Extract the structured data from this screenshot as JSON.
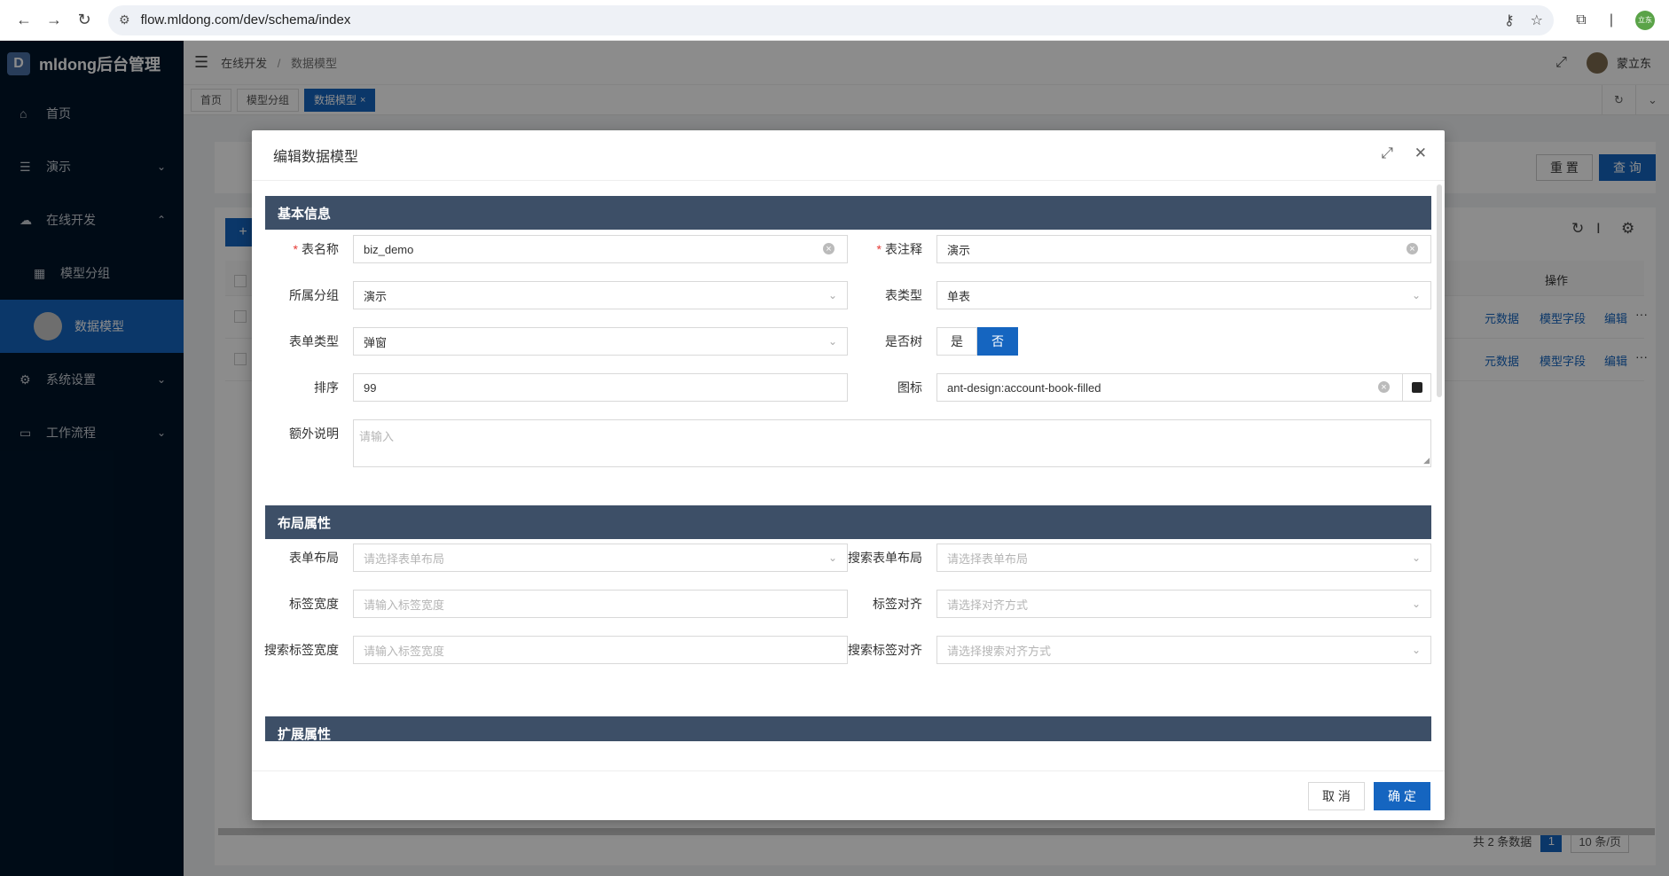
{
  "browser": {
    "url": "flow.mldong.com/dev/schema/index"
  },
  "sidebar": {
    "logo_letter": "D",
    "app_title": "mldong后台管理",
    "items": [
      {
        "label": "首页"
      },
      {
        "label": "演示"
      },
      {
        "label": "在线开发"
      },
      {
        "label": "模型分组"
      },
      {
        "label": "数据模型"
      },
      {
        "label": "系统设置"
      },
      {
        "label": "工作流程"
      }
    ]
  },
  "header": {
    "breadcrumb_parent": "在线开发",
    "breadcrumb_current": "数据模型",
    "breadcrumb_sep": "/",
    "username": "蒙立东",
    "profile_badge": "立东"
  },
  "tabs": [
    {
      "label": "首页"
    },
    {
      "label": "模型分组"
    },
    {
      "label": "数据模型"
    }
  ],
  "search_form": {
    "reset_label": "重 置",
    "query_label": "查 询"
  },
  "table": {
    "add_label": "+",
    "op_header": "操作",
    "row_actions": [
      "元数据",
      "模型字段",
      "编辑",
      "···"
    ],
    "rows": 2
  },
  "pagination": {
    "total_text": "共 2 条数据",
    "current_page": "1",
    "page_size": "10 条/页"
  },
  "modal": {
    "title": "编辑数据模型",
    "sections": {
      "basic": "基本信息",
      "layout": "布局属性",
      "extend": "扩展属性"
    },
    "fields": {
      "table_name_label": "表名称",
      "table_name_value": "biz_demo",
      "table_comment_label": "表注释",
      "table_comment_value": "演示",
      "group_label": "所属分组",
      "group_value": "演示",
      "table_type_label": "表类型",
      "table_type_value": "单表",
      "form_type_label": "表单类型",
      "form_type_value": "弹窗",
      "is_tree_label": "是否树",
      "is_tree_yes": "是",
      "is_tree_no": "否",
      "sort_label": "排序",
      "sort_value": "99",
      "icon_label": "图标",
      "icon_value": "ant-design:account-book-filled",
      "remark_label": "额外说明",
      "remark_placeholder": "请输入",
      "form_layout_label": "表单布局",
      "form_layout_placeholder": "请选择表单布局",
      "search_form_layout_label": "搜索表单布局",
      "search_form_layout_placeholder": "请选择表单布局",
      "label_width_label": "标签宽度",
      "label_width_placeholder": "请输入标签宽度",
      "label_align_label": "标签对齐",
      "label_align_placeholder": "请选择对齐方式",
      "search_label_width_label": "搜索标签宽度",
      "search_label_width_placeholder": "请输入标签宽度",
      "search_label_align_label": "搜索标签对齐",
      "search_label_align_placeholder": "请选择搜索对齐方式"
    },
    "cancel_label": "取 消",
    "ok_label": "确 定"
  },
  "colors": {
    "primary": "#1565c0",
    "sidebar_bg": "#001529",
    "section_bg": "#3d4f67"
  }
}
